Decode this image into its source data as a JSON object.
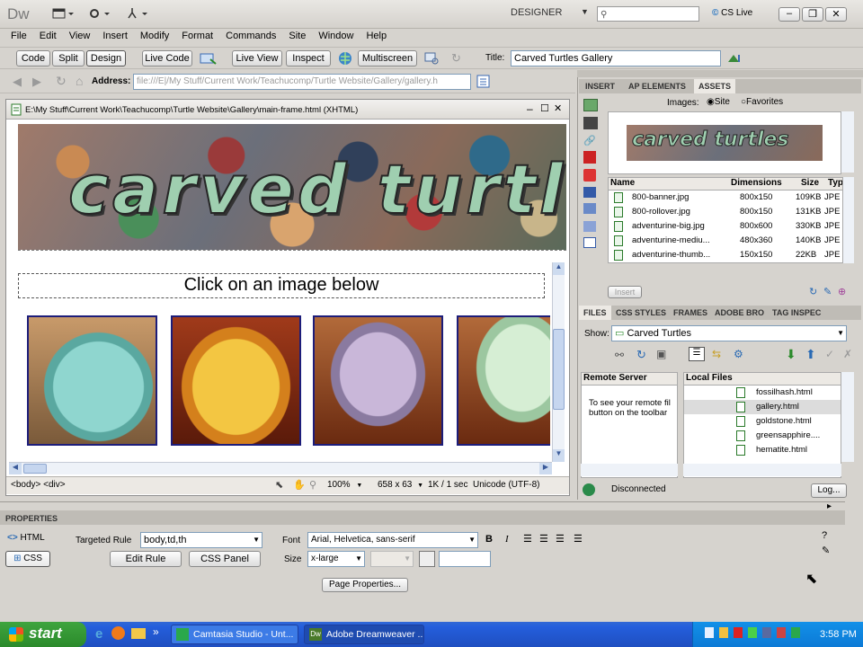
{
  "app": {
    "logo": "Dw",
    "workspace": "DESIGNER",
    "search_placeholder": "",
    "cslive": "CS Live",
    "menus": [
      "File",
      "Edit",
      "View",
      "Insert",
      "Modify",
      "Format",
      "Commands",
      "Site",
      "Window",
      "Help"
    ]
  },
  "doc_toolbar": {
    "code": "Code",
    "split": "Split",
    "design": "Design",
    "live_code": "Live Code",
    "live_view": "Live View",
    "inspect": "Inspect",
    "multiscreen": "Multiscreen",
    "title_label": "Title:",
    "title_value": "Carved Turtles Gallery"
  },
  "address": {
    "label": "Address:",
    "value": "file:///E|/My Stuff/Current Work/Teachucomp/Turtle Website/Gallery/gallery.h"
  },
  "document": {
    "path": "E:\\My Stuff\\Current Work\\Teachucomp\\Turtle Website\\Gallery\\main-frame.html (XHTML)",
    "banner_text": "carved turtle",
    "heading": "Click on an image below",
    "thumb_colors": [
      "#7fc6c0",
      "#e9a92c",
      "#b7a5c4",
      "#c9e6c6"
    ]
  },
  "status": {
    "tags": "<body> <div>",
    "zoom": "100%",
    "size": "658 x 63",
    "weight": "1K / 1 sec",
    "encoding": "Unicode (UTF-8)"
  },
  "assets": {
    "tabs": [
      "INSERT",
      "AP ELEMENTS",
      "ASSETS"
    ],
    "images_label": "Images:",
    "site": "Site",
    "favorites": "Favorites",
    "preview_text": "carved turtles",
    "columns": [
      "Name",
      "Dimensions",
      "Size",
      "Typ"
    ],
    "rows": [
      {
        "name": "800-banner.jpg",
        "dim": "800x150",
        "size": "109KB",
        "type": "JPE"
      },
      {
        "name": "800-rollover.jpg",
        "dim": "800x150",
        "size": "131KB",
        "type": "JPE"
      },
      {
        "name": "adventurine-big.jpg",
        "dim": "800x600",
        "size": "330KB",
        "type": "JPE"
      },
      {
        "name": "adventurine-mediu...",
        "dim": "480x360",
        "size": "140KB",
        "type": "JPE"
      },
      {
        "name": "adventurine-thumb...",
        "dim": "150x150",
        "size": "22KB",
        "type": "JPE"
      }
    ],
    "insert": "Insert"
  },
  "files": {
    "tabs": [
      "FILES",
      "CSS STYLES",
      "FRAMES",
      "ADOBE BRO",
      "TAG INSPEC"
    ],
    "show_label": "Show:",
    "site": "Carved Turtles",
    "remote_header": "Remote Server",
    "local_header": "Local Files",
    "remote_msg_1": "To see your remote fil",
    "remote_msg_2": "button on the toolbar",
    "local": [
      "fossilhash.html",
      "gallery.html",
      "goldstone.html",
      "greensapphire....",
      "hematite.html"
    ],
    "status": "Disconnected",
    "log": "Log..."
  },
  "properties": {
    "title": "PROPERTIES",
    "html": "HTML",
    "css": "CSS",
    "targeted_rule_label": "Targeted Rule",
    "targeted_rule": "body,td,th",
    "edit_rule": "Edit Rule",
    "css_panel": "CSS Panel",
    "font_label": "Font",
    "font_value": "Arial, Helvetica, sans-serif",
    "size_label": "Size",
    "size_value": "x-large",
    "page_properties": "Page Properties..."
  },
  "taskbar": {
    "start": "start",
    "tasks": [
      "Camtasia Studio - Unt...",
      "Adobe Dreamweaver ..."
    ],
    "clock": "3:58 PM"
  }
}
